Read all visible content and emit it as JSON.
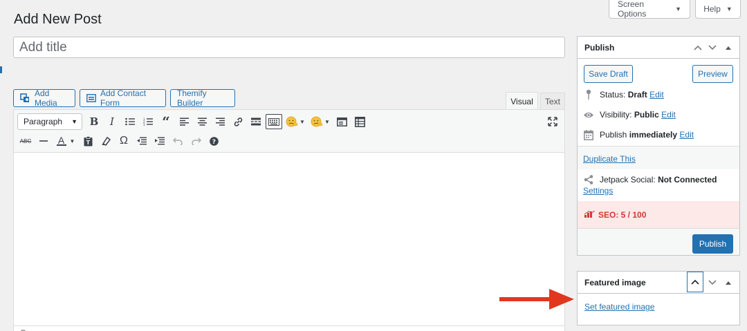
{
  "header": {
    "title": "Add New Post",
    "screen_options_label": "Screen Options",
    "help_label": "Help"
  },
  "title_field": {
    "placeholder": "Add title",
    "value": ""
  },
  "media_buttons": {
    "add_media": "Add Media",
    "add_contact_form": "Add Contact Form",
    "themify_builder": "Themify Builder"
  },
  "editor_tabs": {
    "visual": "Visual",
    "text": "Text",
    "active": "Visual"
  },
  "toolbar": {
    "format_select": "Paragraph",
    "row1_icons": [
      "bold-icon",
      "italic-icon",
      "bulleted-list-icon",
      "numbered-list-icon",
      "blockquote-icon",
      "align-left-icon",
      "align-center-icon",
      "align-right-icon",
      "link-icon",
      "read-more-icon",
      "toolbar-toggle-icon",
      "emoji-icon",
      "emoji-alt-icon",
      "embed-icon",
      "table-icon",
      "fullscreen-icon"
    ],
    "row2_icons": [
      "strikethrough-icon",
      "horizontal-line-icon",
      "text-color-icon",
      "paste-as-text-icon",
      "clear-formatting-icon",
      "special-character-icon",
      "outdent-icon",
      "indent-icon",
      "undo-icon",
      "redo-icon",
      "keyboard-shortcuts-icon"
    ]
  },
  "editor": {
    "statusbar_text": "P"
  },
  "publish_box": {
    "title": "Publish",
    "save_draft": "Save Draft",
    "preview": "Preview",
    "status_label": "Status:",
    "status_value": "Draft",
    "visibility_label": "Visibility:",
    "visibility_value": "Public",
    "publish_label": "Publish",
    "publish_value": "immediately",
    "edit_link": "Edit",
    "duplicate_link": "Duplicate This",
    "jetpack_label": "Jetpack Social:",
    "jetpack_value": "Not Connected",
    "settings_link": "Settings",
    "seo_label": "SEO: 5 / 100",
    "publish_button": "Publish"
  },
  "featured_box": {
    "title": "Featured image",
    "set_link": "Set featured image"
  },
  "colors": {
    "accent": "#2271b1",
    "seo_bg": "#fce9e8",
    "seo_text": "#d63638",
    "arrow": "#e2371f"
  }
}
